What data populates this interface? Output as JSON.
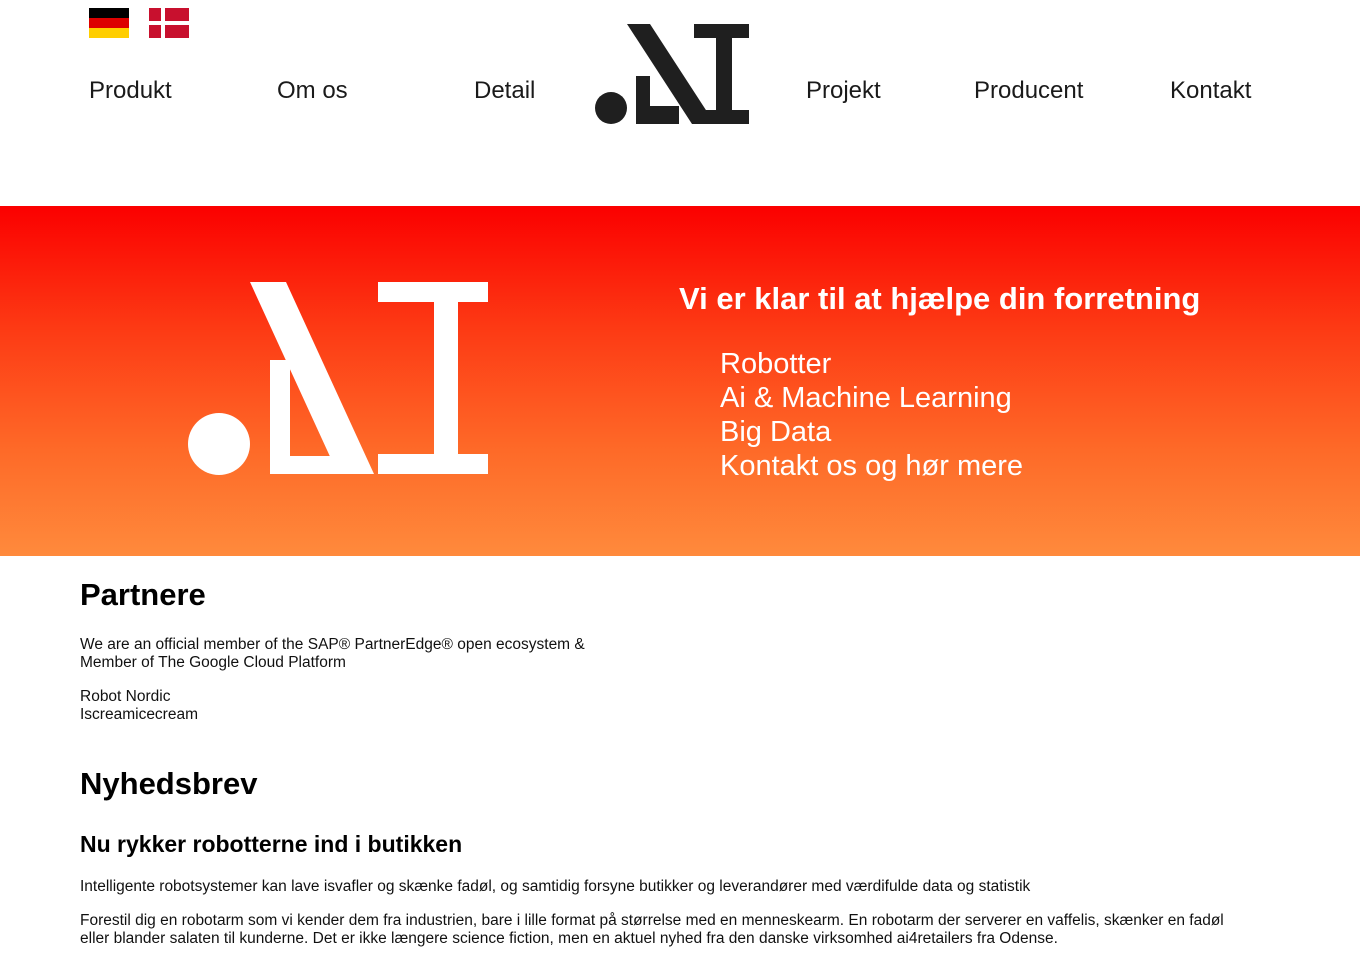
{
  "header": {
    "flags": [
      {
        "name": "german-flag",
        "label": "Deutsch"
      },
      {
        "name": "danish-flag",
        "label": "Dansk"
      }
    ],
    "nav_left": [
      "Produkt",
      "Om os",
      "Detail"
    ],
    "nav_right": [
      "Projekt",
      "Producent",
      "Kontakt"
    ],
    "logo_icon": "ai-logo-icon"
  },
  "hero": {
    "title": "Vi er klar til at hjælpe din forretning",
    "items": [
      "Robotter",
      "Ai & Machine Learning",
      "Big Data",
      "Kontakt os og hør mere"
    ],
    "gradient_top": "#fb0000",
    "gradient_bottom": "#ff8a3c"
  },
  "partners": {
    "heading": "Partnere",
    "intro_line1": "We are an official member of the SAP® PartnerEdge® open ecosystem &",
    "intro_line2": "Member of The Google Cloud Platform",
    "names": [
      "Robot Nordic",
      "Iscreamicecream"
    ]
  },
  "newsletter": {
    "heading": "Nyhedsbrev",
    "article_title": "Nu rykker robotterne ind i butikken",
    "paragraph1": "Intelligente robotsystemer kan lave isvafler og skænke fadøl, og samtidig forsyne butikker og leverandører med værdifulde data og statistik",
    "paragraph2_line1": "Forestil dig en robotarm som vi kender dem fra industrien, bare i lille format på størrelse med en menneskearm. En robotarm der serverer en vaffelis, skænker en fadøl",
    "paragraph2_line2": "eller blander salaten til kunderne. Det er ikke længere science fiction, men en aktuel nyhed fra den danske virksomhed ai4retailers fra Odense."
  }
}
